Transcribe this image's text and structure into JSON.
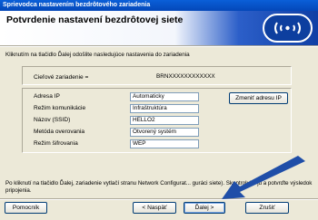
{
  "window": {
    "title": "Sprievodca nastavením bezdrôtového zariadenia"
  },
  "header": {
    "title": "Potvrdenie nastavení bezdrôtovej siete"
  },
  "intro_text": "Kliknutím na tlačidlo Ďalej odošlite nasledujúce nastavenia do zariadenia",
  "target_device": {
    "label": "Cieľové zariadenie =",
    "value": "BRNXXXXXXXXXXXX"
  },
  "settings": [
    {
      "label": "Adresa IP",
      "value": "Automaticky"
    },
    {
      "label": "Režim komunikácie",
      "value": "Infraštruktúra"
    },
    {
      "label": "Názov (SSID)",
      "value": "HELLO2"
    },
    {
      "label": "Metóda overovania",
      "value": "Otvorený systém"
    },
    {
      "label": "Režim šifrovania",
      "value": "WEP"
    }
  ],
  "change_ip_button": "Zmeniť adresu IP",
  "bottom_note": "Po kliknutí na tlačidlo Ďalej, zariadenie vytlačí stranu Network Configurat... guráci siete). Skontrolujte ju a potvrďte výsledok pripojenia.",
  "buttons": {
    "help": "Pomocník",
    "back": "< Naspäť",
    "next": "Ďalej >",
    "cancel": "Zrušiť"
  },
  "colors": {
    "titlebar": "#0a5fd8",
    "header_blue": "#0f3fa5",
    "arrow": "#1f4ea8"
  }
}
